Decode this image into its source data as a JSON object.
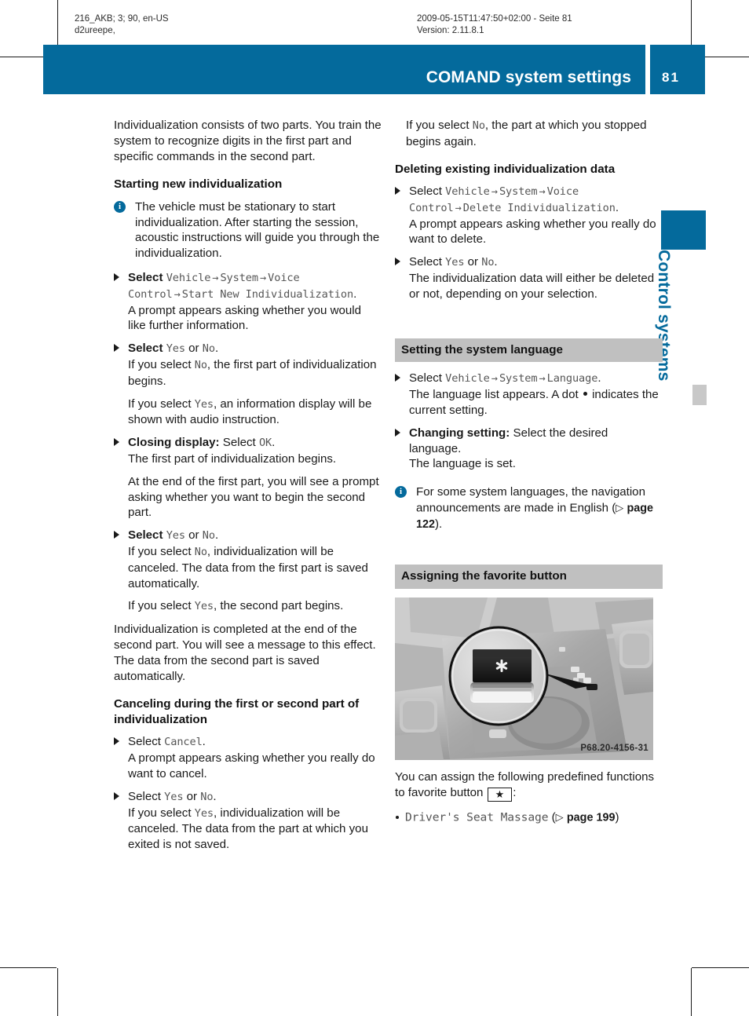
{
  "slug": {
    "left": "216_AKB; 3; 90, en-US\nd2ureepe,",
    "center": "2009-05-15T11:47:50+02:00 - Seite 81\nVersion: 2.11.8.1"
  },
  "header": {
    "title": "COMAND system settings",
    "page_number": "81",
    "accent_color": "#046a9c"
  },
  "thumb_tab": {
    "label": "Control systems"
  },
  "left_column": {
    "intro": "Individualization consists of two parts. You train the system to recognize digits in the first part and specific commands in the second part.",
    "heading_starting": "Starting new individualization",
    "note_stationary": "The vehicle must be stationary to start individualization. After starting the session, acoustic instructions will guide you through the individualization.",
    "step1": {
      "label": "Select",
      "path": [
        "Vehicle",
        "System",
        "Voice Control",
        "Start New Individualization"
      ],
      "result": "A prompt appears asking whether you would like further information."
    },
    "step2": {
      "label": "Select",
      "yes": "Yes",
      "or": "or",
      "no": "No",
      "result_no": "If you select No, the first part of individualization begins.",
      "result_yes": "If you select Yes, an information display will be shown with audio instruction."
    },
    "step3": {
      "bold_label": "Closing display:",
      "label": "Select",
      "value": "OK",
      "result": "The first part of individualization begins.",
      "result2": "At the end of the first part, you will see a prompt asking whether you want to begin the second part."
    },
    "step4": {
      "label": "Select",
      "yes": "Yes",
      "or": "or",
      "no": "No",
      "result_no": "If you select No, individualization will be canceled. The data from the first part is saved automatically.",
      "result_yes": "If you select Yes, the second part begins."
    },
    "closing_para": "Individualization is completed at the end of the second part. You will see a message to this effect. The data from the second part is saved automatically.",
    "heading_canceling": "Canceling during the first or second part of individualization",
    "step5": {
      "label": "Select",
      "value": "Cancel",
      "result": "A prompt appears asking whether you really do want to cancel."
    },
    "step6": {
      "label": "Select",
      "yes": "Yes",
      "or": "or",
      "no": "No",
      "result_yes": "If you select Yes, individualization will be canceled. The data from the part at which you exited is not saved."
    }
  },
  "right_column": {
    "top_result_no": "If you select No, the part at which you stopped begins again.",
    "heading_deleting": "Deleting existing individualization data",
    "step_delete": {
      "label": "Select",
      "path": [
        "Vehicle",
        "System",
        "Voice Control",
        "Delete Individualization"
      ],
      "result": "A prompt appears asking whether you really do want to delete."
    },
    "step_delete_confirm": {
      "label": "Select",
      "yes": "Yes",
      "or": "or",
      "no": "No",
      "result": "The individualization data will either be deleted or not, depending on your selection."
    },
    "section_language": "Setting the system language",
    "step_language": {
      "label": "Select",
      "path": [
        "Vehicle",
        "System",
        "Language"
      ],
      "result_a": "The language list appears. A dot",
      "result_b": "indicates the current setting."
    },
    "step_change": {
      "bold_label": "Changing setting:",
      "text": "Select the desired language.",
      "result": "The language is set."
    },
    "note_language": {
      "text_a": "For some system languages, the navigation announcements are made in English (",
      "xref": "page 122",
      "text_b": ")."
    },
    "section_favorite": "Assigning the favorite button",
    "photo": {
      "code": "P68.20-4156-31",
      "alt": "center-console-favorite-button"
    },
    "favorite_intro_a": "You can assign the following predefined functions to favorite button",
    "favorite_button_glyph": "★",
    "favorite_intro_b": ":",
    "favorite_items": [
      {
        "name": "Driver's Seat Massage",
        "xref": "page 199"
      }
    ]
  }
}
